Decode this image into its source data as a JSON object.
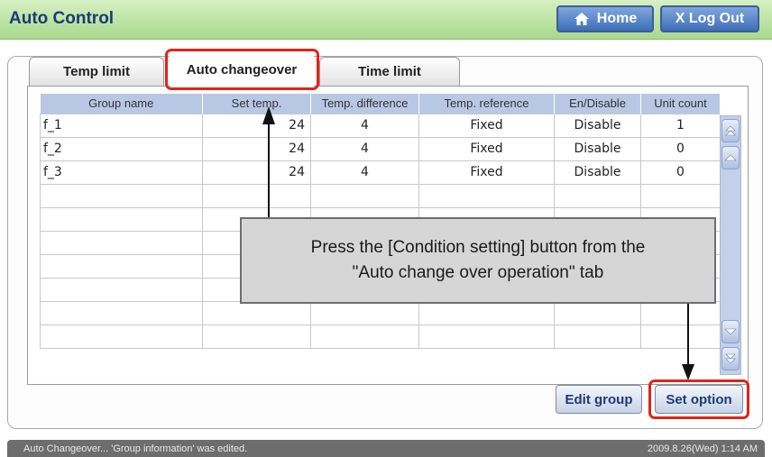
{
  "header": {
    "title": "Auto Control",
    "home_label": "Home",
    "logout_label": "X Log Out"
  },
  "tabs": [
    {
      "label": "Temp limit"
    },
    {
      "label": "Auto changeover"
    },
    {
      "label": "Time limit"
    }
  ],
  "table": {
    "columns": [
      "Group name",
      "Set temp.",
      "Temp. difference",
      "Temp. reference",
      "En/Disable",
      "Unit count"
    ],
    "rows": [
      {
        "group": "f_1",
        "set_temp": "24",
        "temp_diff": "4",
        "temp_ref": "Fixed",
        "enable": "Disable",
        "units": "1"
      },
      {
        "group": "f_2",
        "set_temp": "24",
        "temp_diff": "4",
        "temp_ref": "Fixed",
        "enable": "Disable",
        "units": "0"
      },
      {
        "group": "f_3",
        "set_temp": "24",
        "temp_diff": "4",
        "temp_ref": "Fixed",
        "enable": "Disable",
        "units": "0"
      }
    ]
  },
  "callout": {
    "line1": "Press the [Condition setting] button from the",
    "line2": "\"Auto change over operation\" tab"
  },
  "buttons": {
    "edit_group": "Edit group",
    "set_option": "Set option"
  },
  "status": {
    "message": "Auto Changeover... 'Group information' was edited.",
    "datetime": "2009.8.26(Wed)  1:14 AM"
  },
  "colors": {
    "header_bg": "#a8d98c",
    "title_text": "#1c3a78",
    "highlight": "#e2231a",
    "table_header": "#b8c8e4"
  }
}
